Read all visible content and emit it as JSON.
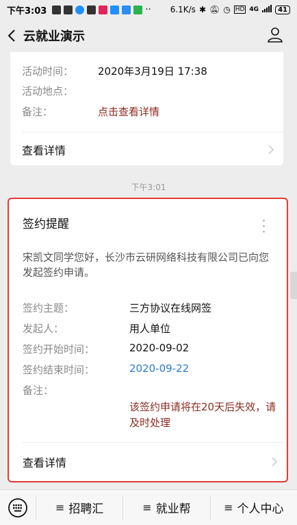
{
  "status_bar": {
    "time": "下午3:03",
    "network_speed": "6.1K/s",
    "signal_label": "4G",
    "battery": "41",
    "notification_icon_colors": [
      "#333333",
      "#333333",
      "#1e90ff",
      "#333333",
      "#e0245e",
      "#1e90ff",
      "#2d8cf0",
      "#2bb24c"
    ]
  },
  "nav": {
    "title": "云就业演示"
  },
  "first_card": {
    "rows": [
      {
        "label": "活动时间：",
        "value": "2020年3月19日 17:38"
      },
      {
        "label": "活动地点：",
        "value": ""
      },
      {
        "label": "备注：",
        "value": "点击查看详情"
      }
    ],
    "detail_label": "查看详情"
  },
  "timestamp": "下午3:01",
  "sign_card": {
    "title": "签约提醒",
    "intro": "宋凯文同学您好，长沙市云研网络科技有限公司已向您发起签约申请。",
    "rows": [
      {
        "label": "签约主题：",
        "value": "三方协议在线网签"
      },
      {
        "label": "发起人：",
        "value": "用人单位"
      },
      {
        "label": "签约开始时间：",
        "value": "2020-09-02"
      },
      {
        "label": "签约结束时间：",
        "value": "2020-09-22"
      },
      {
        "label": "备注：",
        "value": ""
      }
    ],
    "note": "该签约申请将在20天后失效，请及时处理",
    "detail_label": "查看详情",
    "highlight_color": "#e53a2f"
  },
  "bottom_menu": {
    "items": [
      {
        "label": "招聘汇"
      },
      {
        "label": "就业帮"
      },
      {
        "label": "个人中心"
      }
    ],
    "menu_glyph": "≡"
  },
  "colors": {
    "note_text": "#8b2b20",
    "date_link": "#2a7bc8"
  }
}
